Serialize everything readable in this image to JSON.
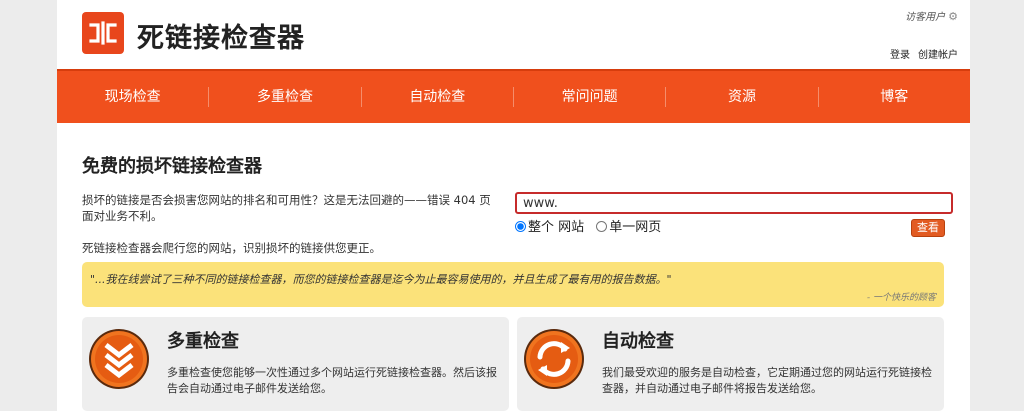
{
  "header": {
    "site_title": "死链接检查器",
    "guest_label": "访客用户",
    "login_label": "登录",
    "create_account_label": "创建帐户"
  },
  "nav": {
    "items": [
      "现场检查",
      "多重检查",
      "自动检查",
      "常问问题",
      "资源",
      "博客"
    ]
  },
  "main": {
    "title": "免费的损坏链接检查器",
    "intro_text": "损坏的链接是否会损害您网站的排名和可用性？这是无法回避的——错误 404 页面对业务不利。",
    "intro_text2": "死链接检查器会爬行您的网站，识别损坏的链接供您更正。",
    "url_input_value": "www.",
    "radio_whole_site": "整个 网站",
    "radio_single_page": "单一网页",
    "check_button": "查看"
  },
  "quote": {
    "text": "\"...我在线尝试了三种不同的链接检查器，而您的链接检查器是迄今为止最容易使用的，并且生成了最有用的报告数据。\"",
    "author": "- 一个快乐的顾客"
  },
  "features": [
    {
      "title": "多重检查",
      "description": "多重检查使您能够一次性通过多个网站运行死链接检查器。然后该报告会自动通过电子邮件发送给您。",
      "icon": "multi-check-icon"
    },
    {
      "title": "自动检查",
      "description": "我们最受欢迎的服务是自动检查，它定期通过您的网站运行死链接检查器，并自动通过电子邮件将报告发送给您。",
      "icon": "auto-check-icon"
    }
  ],
  "colors": {
    "brand": "#f0501d",
    "quote_bg": "#fbe27a",
    "input_border": "#c62b2b"
  }
}
